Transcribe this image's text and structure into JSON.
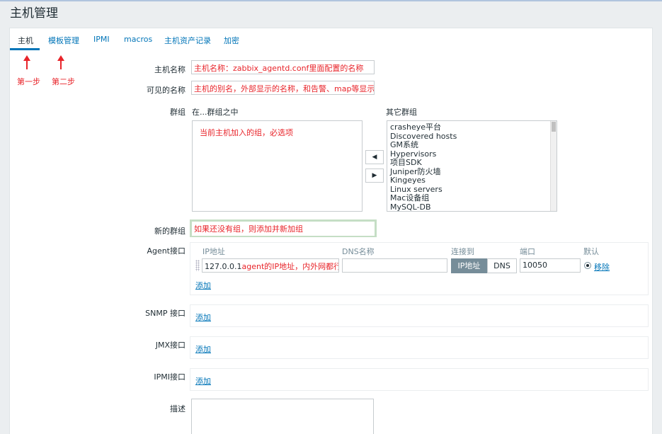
{
  "page": {
    "title": "主机管理"
  },
  "tabs": [
    {
      "label": "主机"
    },
    {
      "label": "模板管理"
    },
    {
      "label": "IPMI"
    },
    {
      "label": "macros"
    },
    {
      "label": "主机资产记录"
    },
    {
      "label": "加密"
    }
  ],
  "annotations": {
    "step1": "第一步",
    "step2": "第二步"
  },
  "form": {
    "host_name_label": "主机名称",
    "host_name_value": "主机名称：zabbix_agentd.conf里面配置的名称",
    "visible_name_label": "可见的名称",
    "visible_name_value": "主机的别名，外部显示的名称，和告警、map等显示有关联",
    "groups_label": "群组",
    "in_groups_label": "在...群组之中",
    "other_groups_label": "其它群组",
    "in_groups_note": "当前主机加入的组，必选项",
    "other_groups": [
      "crasheye平台",
      "Discovered hosts",
      "GM系统",
      "Hypervisors",
      "项目SDK",
      "Juniper防火墙",
      "Kingeyes",
      "Linux servers",
      "Mac设备组",
      "MySQL-DB"
    ],
    "move_left": "◀",
    "move_right": "▶",
    "new_group_label": "新的群组",
    "new_group_value": "如果还没有组，则添加并新加组",
    "agent_label": "Agent接口",
    "col_ip": "IP地址",
    "col_dns": "DNS名称",
    "col_connect": "连接到",
    "col_port": "端口",
    "col_default": "默认",
    "ip_value": "127.0.0.1",
    "ip_note": "agent的IP地址，内外网都行",
    "dns_value": "",
    "connect_ip": "IP地址",
    "connect_dns": "DNS",
    "port_value": "10050",
    "remove_link": "移除",
    "add_link": "添加",
    "snmp_label": "SNMP 接口",
    "jmx_label": "JMX接口",
    "ipmi_label": "IPMI接口",
    "description_label": "描述"
  }
}
